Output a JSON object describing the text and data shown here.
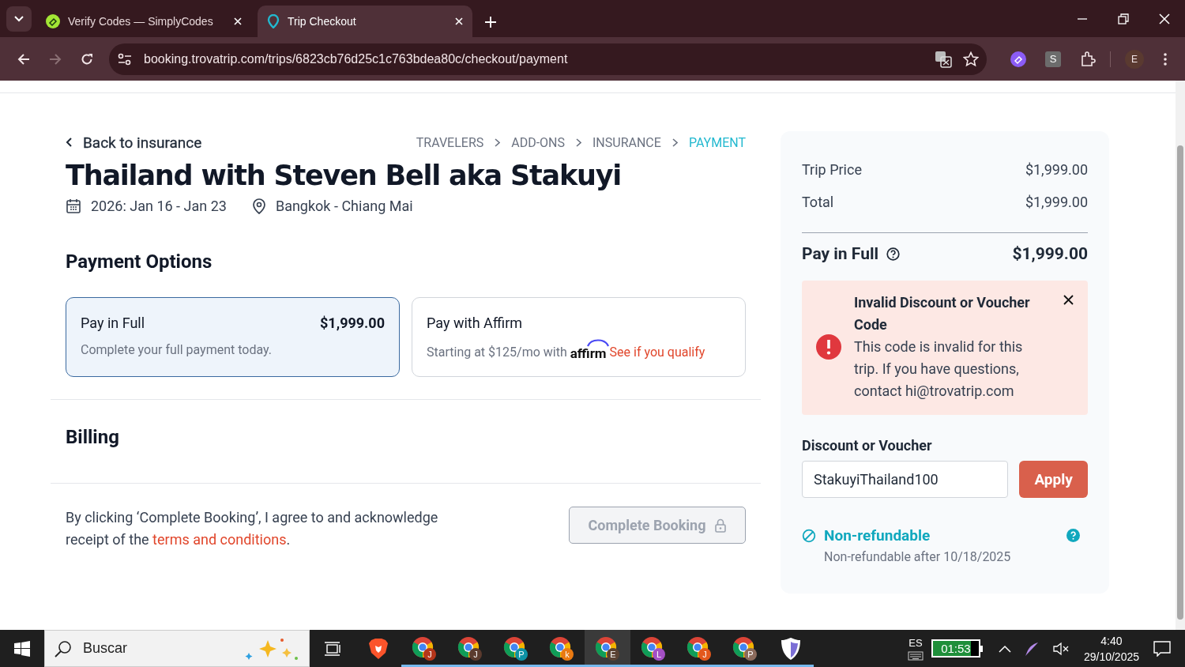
{
  "browser": {
    "tabs": [
      {
        "title": "Verify Codes — SimplyCodes",
        "selected": false
      },
      {
        "title": "Trip Checkout",
        "selected": true
      }
    ],
    "url": "booking.trovatrip.com/trips/6823cb76d25c1c763bdea80c/checkout/payment",
    "extension_label": "S",
    "profile_initial": "E"
  },
  "checkout": {
    "back_link": "Back to insurance",
    "steps": [
      {
        "label": "TRAVELERS",
        "selected": false
      },
      {
        "label": "ADD-ONS",
        "selected": false
      },
      {
        "label": "INSURANCE",
        "selected": false
      },
      {
        "label": "PAYMENT",
        "selected": true
      }
    ],
    "title": "Thailand with Steven Bell aka Stakuyi",
    "dates": "2026: Jan 16 - Jan 23",
    "location": "Bangkok - Chiang Mai",
    "payment_heading": "Payment Options",
    "options": [
      {
        "kind": "full",
        "title": "Pay in Full",
        "price": "$1,999.00",
        "description": "Complete your full payment today.",
        "selected": true
      },
      {
        "kind": "affirm",
        "title": "Pay with Affirm",
        "description": "Starting at $125/mo with",
        "brand": "affirm",
        "link": "See if you qualify",
        "selected": false
      }
    ],
    "billing_heading": "Billing",
    "agreement": "By clicking ‘Complete Booking’, I agree to and acknowledge receipt of the",
    "terms_link": "terms and conditions",
    "agreement_end": ".",
    "complete_button": {
      "label": "Complete Booking",
      "disabled": true
    }
  },
  "summary": {
    "lines": [
      {
        "label": "Trip Price",
        "amount": "$1,999.00"
      },
      {
        "label": "Total",
        "amount": "$1,999.00"
      }
    ],
    "pay_label": "Pay in Full",
    "pay_amount": "$1,999.00",
    "alert": {
      "title": "Invalid Discount or Voucher Code",
      "message": "This code is invalid for this trip. If you have questions, contact hi@trovatrip.com"
    },
    "discount_label": "Discount or Voucher",
    "discount_value": "StakuyiThailand100",
    "apply": "Apply",
    "refund_title": "Non-refundable",
    "refund_note": "Non-refundable after 10/18/2025"
  },
  "taskbar": {
    "search_placeholder": "Buscar",
    "apps": [
      {
        "kind": "brave",
        "running": false,
        "active": false
      },
      {
        "kind": "chrome",
        "badge": "J",
        "color": "#b5361b",
        "running": true,
        "active": false
      },
      {
        "kind": "chrome",
        "badge": "J",
        "color": "#5b3b2e",
        "running": true,
        "active": false
      },
      {
        "kind": "chrome",
        "badge": "P",
        "color": "#0e93a5",
        "running": true,
        "active": false
      },
      {
        "kind": "chrome",
        "badge": "k",
        "color": "#ea7a12",
        "running": true,
        "active": false
      },
      {
        "kind": "chrome",
        "badge": "E",
        "color": "#5a4233",
        "running": true,
        "active": true
      },
      {
        "kind": "chrome",
        "badge": "L",
        "color": "#a34fc4",
        "running": true,
        "active": false
      },
      {
        "kind": "chrome",
        "badge": "J",
        "color": "#e3581c",
        "running": true,
        "active": false
      },
      {
        "kind": "chrome",
        "badge": "P",
        "color": "#8c6b5c",
        "running": true,
        "active": false
      },
      {
        "kind": "shield",
        "running": true,
        "active": false
      }
    ],
    "language": "ES",
    "battery": "01:53",
    "time": "4:40",
    "date": "29/10/2025"
  }
}
